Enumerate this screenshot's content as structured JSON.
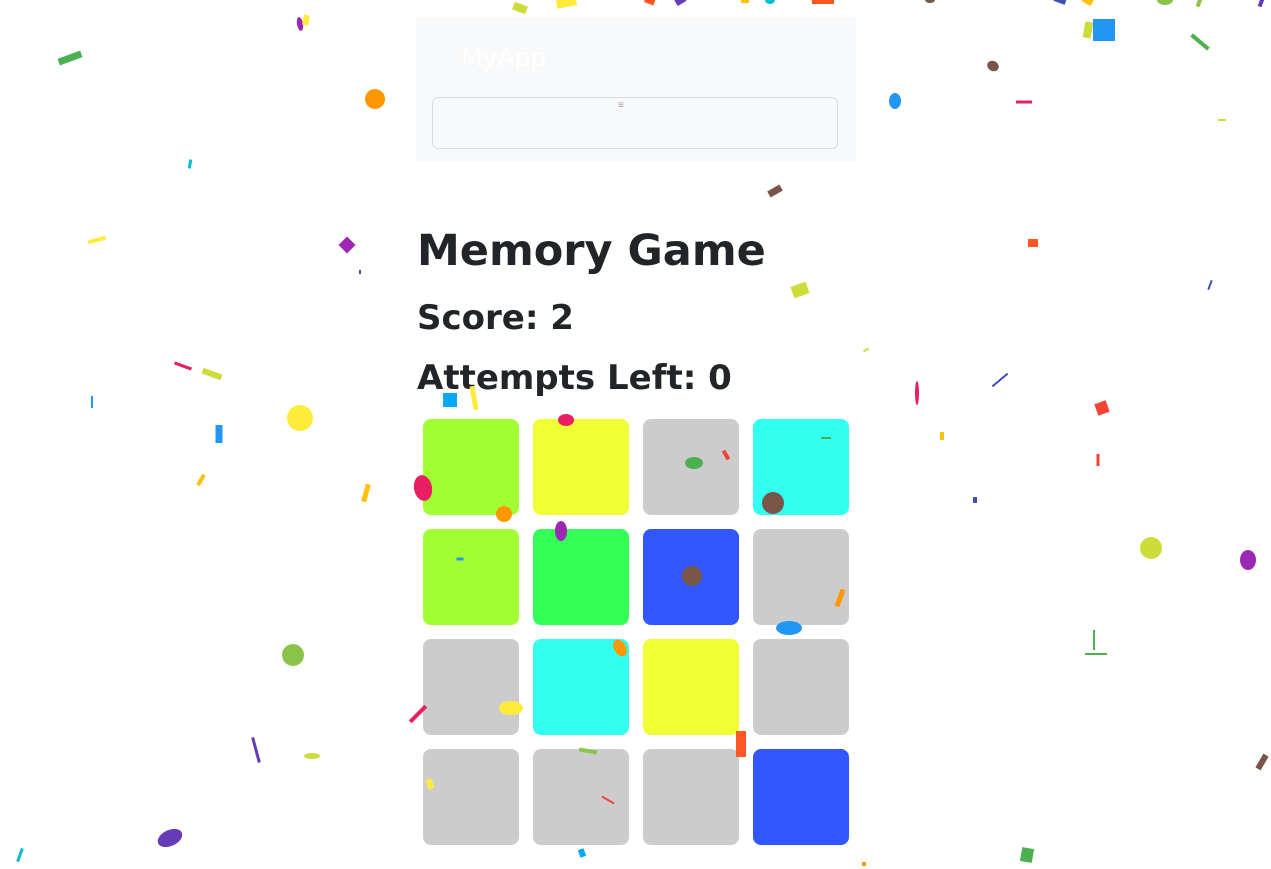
{
  "navbar": {
    "brand": "MyApp",
    "toggler_icon": "hamburger-icon",
    "toggler_glyph": "≡"
  },
  "game": {
    "title": "Memory Game",
    "score_label": "Score: 2",
    "attempts_label": "Attempts Left: 0",
    "score": 2,
    "attempts_left": 0
  },
  "board": {
    "rows": 4,
    "columns": 4,
    "cards": [
      {
        "state": "revealed",
        "color": "#a2ff33"
      },
      {
        "state": "revealed",
        "color": "#f0ff33"
      },
      {
        "state": "hidden",
        "color": "#cccccc"
      },
      {
        "state": "revealed",
        "color": "#33fff0"
      },
      {
        "state": "revealed",
        "color": "#a2ff33"
      },
      {
        "state": "revealed",
        "color": "#33ff57"
      },
      {
        "state": "revealed",
        "color": "#3357ff"
      },
      {
        "state": "hidden",
        "color": "#cccccc"
      },
      {
        "state": "hidden",
        "color": "#cccccc"
      },
      {
        "state": "revealed",
        "color": "#33fff0"
      },
      {
        "state": "revealed",
        "color": "#f0ff33"
      },
      {
        "state": "hidden",
        "color": "#cccccc"
      },
      {
        "state": "hidden",
        "color": "#cccccc"
      },
      {
        "state": "hidden",
        "color": "#cccccc"
      },
      {
        "state": "hidden",
        "color": "#cccccc"
      },
      {
        "state": "revealed",
        "color": "#3357ff"
      }
    ]
  },
  "colors": {
    "navbar_bg": "#f8f9fa",
    "text": "#212529",
    "hidden_card": "#cccccc"
  },
  "confetti_palette": [
    "#f44336",
    "#e91e63",
    "#9c27b0",
    "#673ab7",
    "#3f51b5",
    "#2196f3",
    "#03a9f4",
    "#00bcd4",
    "#009688",
    "#4caf50",
    "#8bc34a",
    "#cddc39",
    "#ffeb3b",
    "#ffc107",
    "#ff9800",
    "#ff5722",
    "#795548"
  ]
}
